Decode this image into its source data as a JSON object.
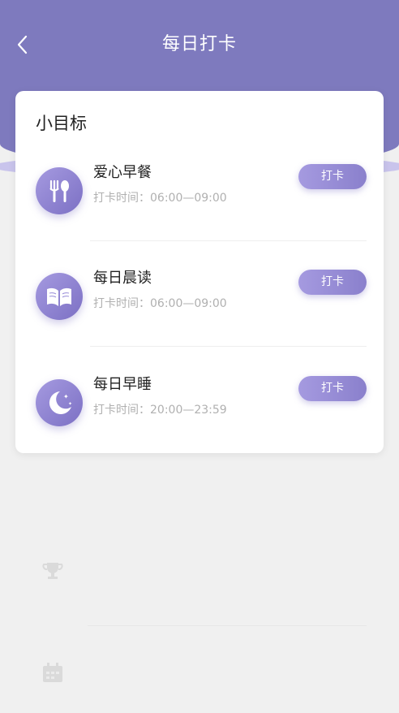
{
  "header": {
    "title": "每日打卡",
    "bg_color": "#7e7abe"
  },
  "card": {
    "title": "小目标",
    "tasks": [
      {
        "name": "爱心早餐",
        "time": "打卡时间：06:00—09:00",
        "button": "打卡",
        "icon": "fork-spoon-icon"
      },
      {
        "name": "每日晨读",
        "time": "打卡时间：06:00—09:00",
        "button": "打卡",
        "icon": "book-icon"
      },
      {
        "name": "每日早睡",
        "time": "打卡时间：20:00—23:59",
        "button": "打卡",
        "icon": "moon-stars-icon"
      }
    ]
  },
  "accent_color": "#8a80cc"
}
